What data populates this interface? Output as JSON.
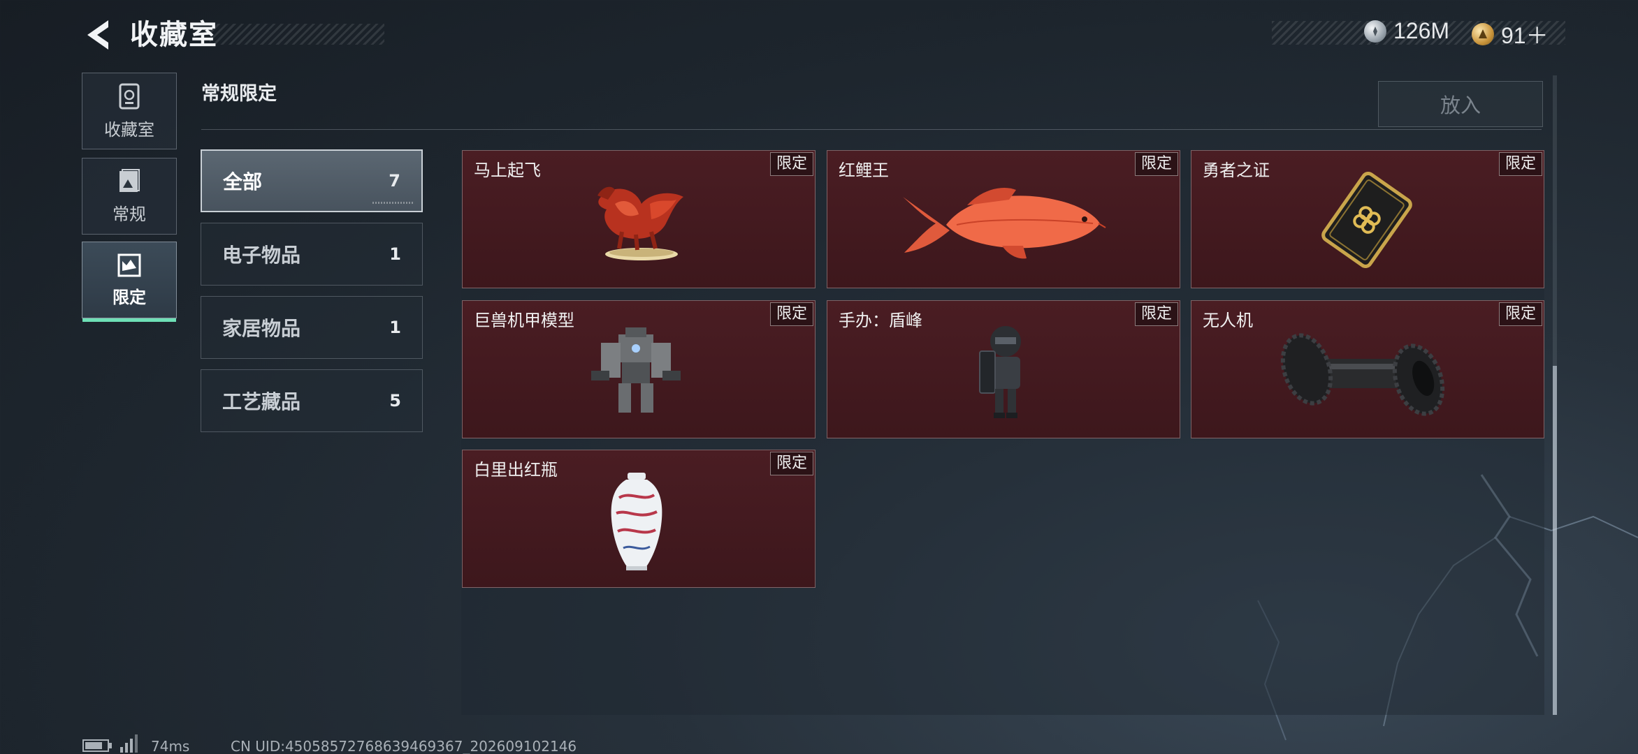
{
  "header": {
    "title": "收藏室",
    "currencies": [
      {
        "icon": "silver-coin-icon",
        "value": "126M"
      },
      {
        "icon": "gold-coin-icon",
        "value": "91＋"
      }
    ]
  },
  "nav": [
    {
      "label": "收藏室",
      "icon": "vault-icon",
      "active": false
    },
    {
      "label": "常规",
      "icon": "photo-frame-icon",
      "active": false
    },
    {
      "label": "限定",
      "icon": "limited-frame-icon",
      "active": true
    }
  ],
  "section": {
    "title": "常规限定",
    "put_in_label": "放入"
  },
  "categories": [
    {
      "label": "全部",
      "count": "7",
      "active": true
    },
    {
      "label": "电子物品",
      "count": "1",
      "active": false
    },
    {
      "label": "家居物品",
      "count": "1",
      "active": false
    },
    {
      "label": "工艺藏品",
      "count": "5",
      "active": false
    }
  ],
  "items": [
    {
      "name": "马上起飞",
      "badge": "限定",
      "icon": "golden-horse-icon"
    },
    {
      "name": "红鲤王",
      "badge": "限定",
      "icon": "red-carp-icon"
    },
    {
      "name": "勇者之证",
      "badge": "限定",
      "icon": "gold-card-icon"
    },
    {
      "name": "巨兽机甲模型",
      "badge": "限定",
      "icon": "mecha-model-icon"
    },
    {
      "name": "手办：盾峰",
      "badge": "限定",
      "icon": "shield-figure-icon"
    },
    {
      "name": "无人机",
      "badge": "限定",
      "icon": "drone-part-icon"
    },
    {
      "name": "白里出红瓶",
      "badge": "限定",
      "icon": "porcelain-vase-icon"
    }
  ],
  "status": {
    "ping": "74ms",
    "uid": "CN UID:4505857276863946936​7_202609102146"
  },
  "colors": {
    "card_bg": "#4a1d23",
    "accent_green": "#6ee0b6"
  }
}
